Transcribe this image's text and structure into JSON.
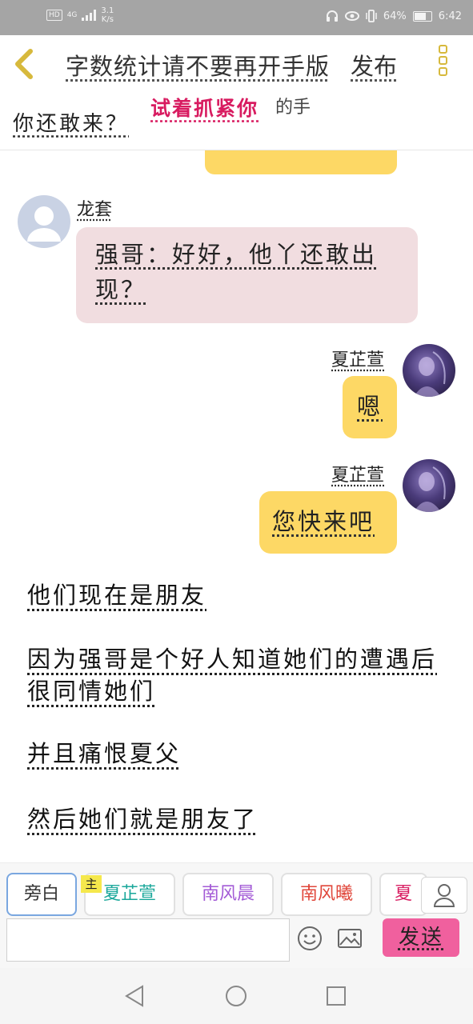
{
  "status_bar": {
    "hd": "HD",
    "network": "4G",
    "speed": "3.1",
    "speed_unit": "K/s",
    "battery": "64%",
    "battery_level": 0.64,
    "time": "6:42"
  },
  "top_bar": {
    "title": "字数统计请不要再开手版",
    "publish": "发布"
  },
  "pinned": {
    "text": "你还敢来？",
    "overlay": "试着抓紧你",
    "overlay_tail": "的手"
  },
  "messages": [
    {
      "speaker": "龙套",
      "text": "强哥：好好，他丫还敢出现？",
      "side": "left"
    },
    {
      "speaker": "夏芷萱",
      "text": "嗯",
      "side": "right"
    },
    {
      "speaker": "夏芷萱",
      "text": "您快来吧",
      "side": "right"
    }
  ],
  "narration": [
    "他们现在是朋友",
    "因为强哥是个好人知道她们的遭遇后很同情她们",
    "并且痛恨夏父",
    "然后她们就是朋友了"
  ],
  "characters": {
    "main_badge": "主",
    "chips": [
      "旁白",
      "夏芷萱",
      "南风晨",
      "南风曦",
      "夏"
    ]
  },
  "input": {
    "placeholder": "",
    "send": "发送"
  },
  "colors": {
    "accent_yellow": "#fdd865",
    "pink_bubble": "#f1dde0",
    "send_pink": "#f0609e",
    "overlay_red": "#d81b60"
  }
}
